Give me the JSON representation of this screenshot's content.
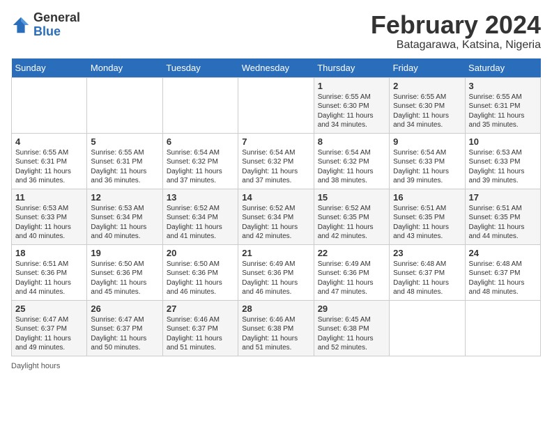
{
  "header": {
    "logo_general": "General",
    "logo_blue": "Blue",
    "main_title": "February 2024",
    "subtitle": "Batagarawa, Katsina, Nigeria"
  },
  "days_of_week": [
    "Sunday",
    "Monday",
    "Tuesday",
    "Wednesday",
    "Thursday",
    "Friday",
    "Saturday"
  ],
  "weeks": [
    [
      {
        "day": "",
        "info": ""
      },
      {
        "day": "",
        "info": ""
      },
      {
        "day": "",
        "info": ""
      },
      {
        "day": "",
        "info": ""
      },
      {
        "day": "1",
        "info": "Sunrise: 6:55 AM\nSunset: 6:30 PM\nDaylight: 11 hours and 34 minutes."
      },
      {
        "day": "2",
        "info": "Sunrise: 6:55 AM\nSunset: 6:30 PM\nDaylight: 11 hours and 34 minutes."
      },
      {
        "day": "3",
        "info": "Sunrise: 6:55 AM\nSunset: 6:31 PM\nDaylight: 11 hours and 35 minutes."
      }
    ],
    [
      {
        "day": "4",
        "info": "Sunrise: 6:55 AM\nSunset: 6:31 PM\nDaylight: 11 hours and 36 minutes."
      },
      {
        "day": "5",
        "info": "Sunrise: 6:55 AM\nSunset: 6:31 PM\nDaylight: 11 hours and 36 minutes."
      },
      {
        "day": "6",
        "info": "Sunrise: 6:54 AM\nSunset: 6:32 PM\nDaylight: 11 hours and 37 minutes."
      },
      {
        "day": "7",
        "info": "Sunrise: 6:54 AM\nSunset: 6:32 PM\nDaylight: 11 hours and 37 minutes."
      },
      {
        "day": "8",
        "info": "Sunrise: 6:54 AM\nSunset: 6:32 PM\nDaylight: 11 hours and 38 minutes."
      },
      {
        "day": "9",
        "info": "Sunrise: 6:54 AM\nSunset: 6:33 PM\nDaylight: 11 hours and 39 minutes."
      },
      {
        "day": "10",
        "info": "Sunrise: 6:53 AM\nSunset: 6:33 PM\nDaylight: 11 hours and 39 minutes."
      }
    ],
    [
      {
        "day": "11",
        "info": "Sunrise: 6:53 AM\nSunset: 6:33 PM\nDaylight: 11 hours and 40 minutes."
      },
      {
        "day": "12",
        "info": "Sunrise: 6:53 AM\nSunset: 6:34 PM\nDaylight: 11 hours and 40 minutes."
      },
      {
        "day": "13",
        "info": "Sunrise: 6:52 AM\nSunset: 6:34 PM\nDaylight: 11 hours and 41 minutes."
      },
      {
        "day": "14",
        "info": "Sunrise: 6:52 AM\nSunset: 6:34 PM\nDaylight: 11 hours and 42 minutes."
      },
      {
        "day": "15",
        "info": "Sunrise: 6:52 AM\nSunset: 6:35 PM\nDaylight: 11 hours and 42 minutes."
      },
      {
        "day": "16",
        "info": "Sunrise: 6:51 AM\nSunset: 6:35 PM\nDaylight: 11 hours and 43 minutes."
      },
      {
        "day": "17",
        "info": "Sunrise: 6:51 AM\nSunset: 6:35 PM\nDaylight: 11 hours and 44 minutes."
      }
    ],
    [
      {
        "day": "18",
        "info": "Sunrise: 6:51 AM\nSunset: 6:36 PM\nDaylight: 11 hours and 44 minutes."
      },
      {
        "day": "19",
        "info": "Sunrise: 6:50 AM\nSunset: 6:36 PM\nDaylight: 11 hours and 45 minutes."
      },
      {
        "day": "20",
        "info": "Sunrise: 6:50 AM\nSunset: 6:36 PM\nDaylight: 11 hours and 46 minutes."
      },
      {
        "day": "21",
        "info": "Sunrise: 6:49 AM\nSunset: 6:36 PM\nDaylight: 11 hours and 46 minutes."
      },
      {
        "day": "22",
        "info": "Sunrise: 6:49 AM\nSunset: 6:36 PM\nDaylight: 11 hours and 47 minutes."
      },
      {
        "day": "23",
        "info": "Sunrise: 6:48 AM\nSunset: 6:37 PM\nDaylight: 11 hours and 48 minutes."
      },
      {
        "day": "24",
        "info": "Sunrise: 6:48 AM\nSunset: 6:37 PM\nDaylight: 11 hours and 48 minutes."
      }
    ],
    [
      {
        "day": "25",
        "info": "Sunrise: 6:47 AM\nSunset: 6:37 PM\nDaylight: 11 hours and 49 minutes."
      },
      {
        "day": "26",
        "info": "Sunrise: 6:47 AM\nSunset: 6:37 PM\nDaylight: 11 hours and 50 minutes."
      },
      {
        "day": "27",
        "info": "Sunrise: 6:46 AM\nSunset: 6:37 PM\nDaylight: 11 hours and 51 minutes."
      },
      {
        "day": "28",
        "info": "Sunrise: 6:46 AM\nSunset: 6:38 PM\nDaylight: 11 hours and 51 minutes."
      },
      {
        "day": "29",
        "info": "Sunrise: 6:45 AM\nSunset: 6:38 PM\nDaylight: 11 hours and 52 minutes."
      },
      {
        "day": "",
        "info": ""
      },
      {
        "day": "",
        "info": ""
      }
    ]
  ],
  "footer": "Daylight hours"
}
